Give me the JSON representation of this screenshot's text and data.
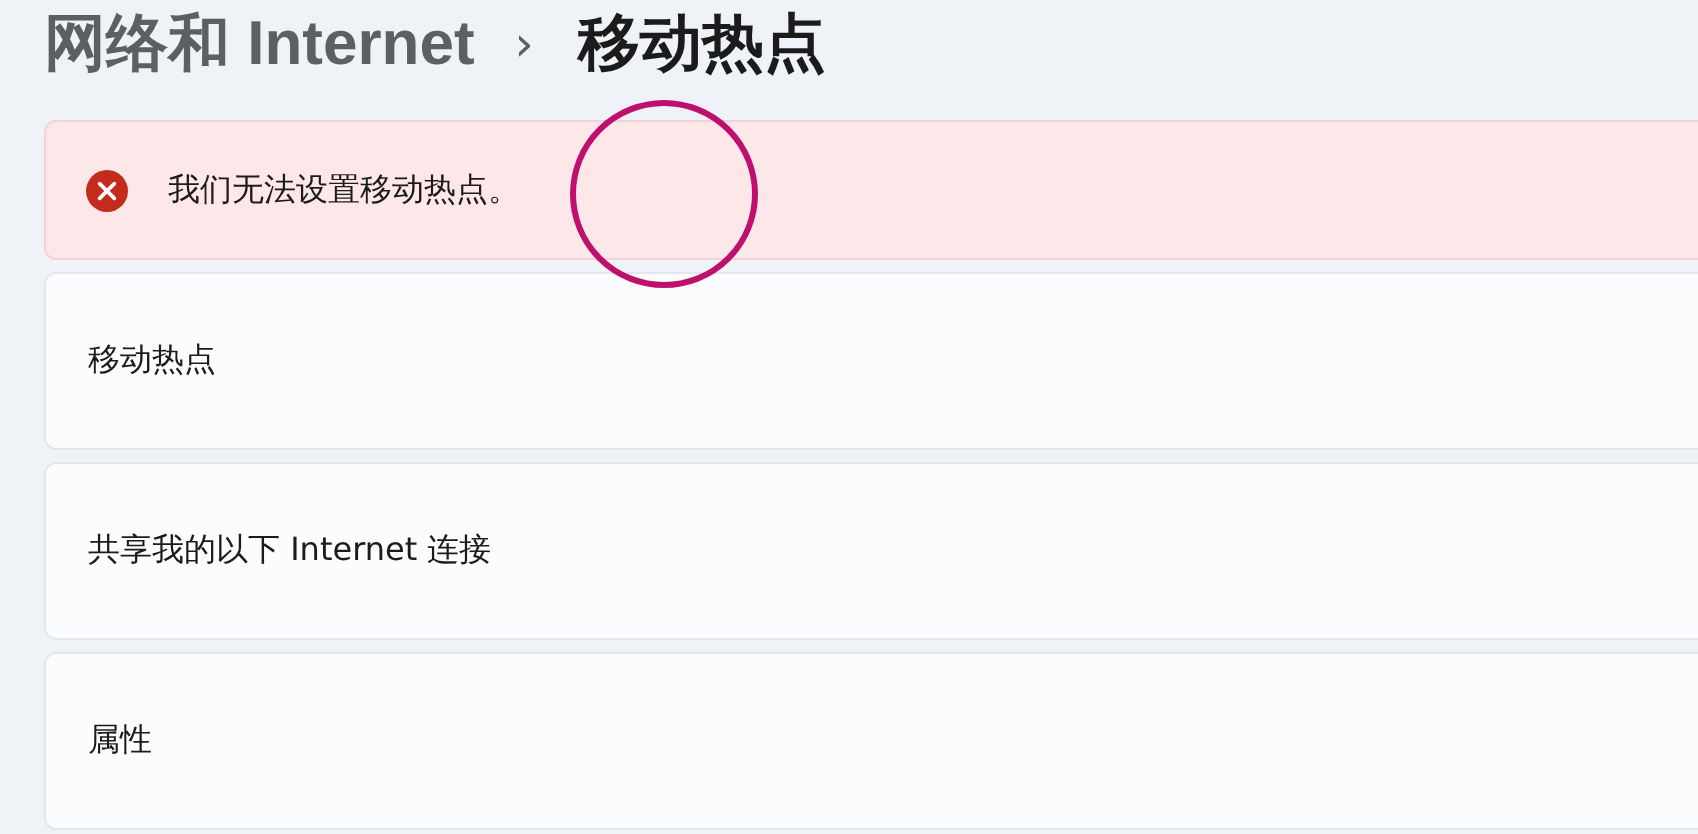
{
  "breadcrumb": {
    "parent": "网络和 Internet",
    "separator": "›",
    "current": "移动热点"
  },
  "error_banner": {
    "kind": "error",
    "message": "我们无法设置移动热点。"
  },
  "cards": [
    {
      "label": "移动热点"
    },
    {
      "label": "共享我的以下 Internet 连接"
    },
    {
      "label": "属性"
    }
  ]
}
